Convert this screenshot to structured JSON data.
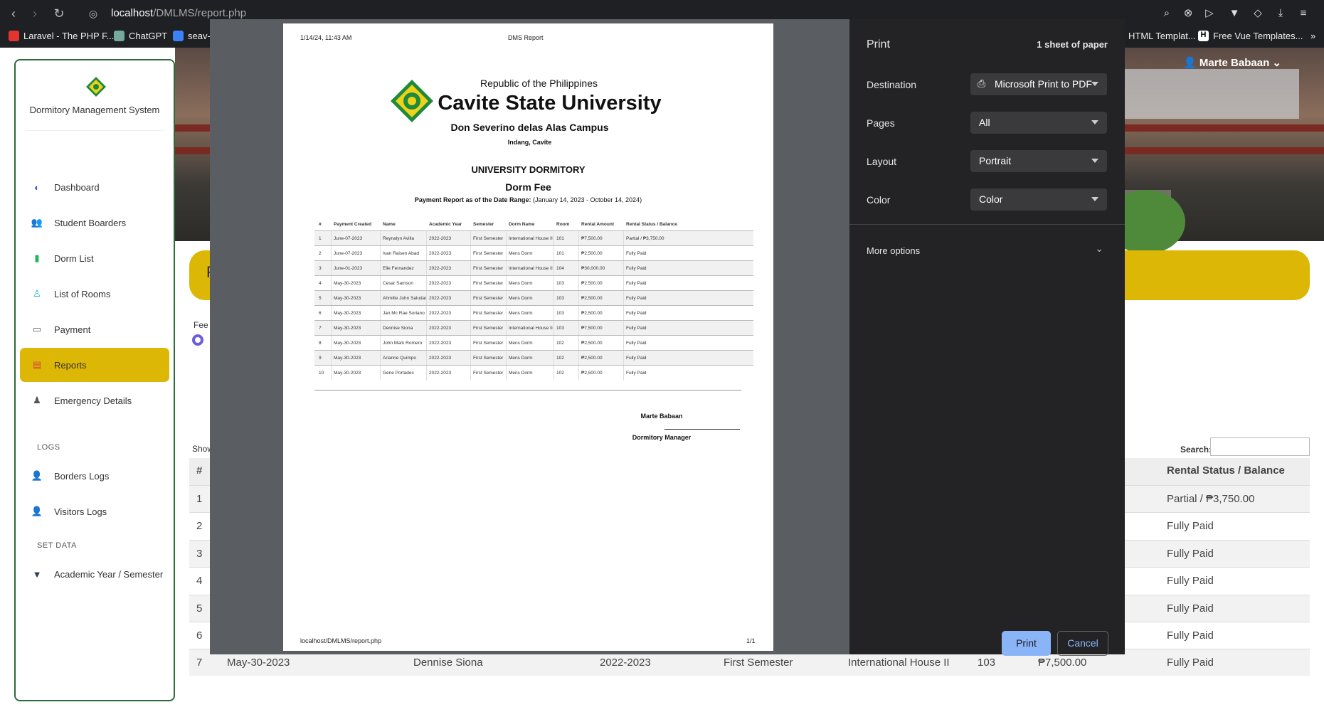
{
  "browser": {
    "url_host": "localhost",
    "url_path": "/DMLMS/report.php",
    "bookmarks": [
      {
        "label": "Laravel - The PHP F...",
        "color": "#e3342f"
      },
      {
        "label": "ChatGPT",
        "color": "#74aa9c"
      },
      {
        "label": "seav-c",
        "color": "#3b82f6"
      },
      {
        "label": "HTML Templat...",
        "color": "#888888"
      },
      {
        "label": "Free Vue Templates...",
        "color": "#ffffff"
      }
    ]
  },
  "header": {
    "user_name": "Marte Babaan"
  },
  "sidebar": {
    "brand": "Dormitory Management System",
    "items": [
      {
        "label": "Dashboard",
        "icon": "gauge-icon"
      },
      {
        "label": "Student Boarders",
        "icon": "users-icon"
      },
      {
        "label": "Dorm List",
        "icon": "building-icon"
      },
      {
        "label": "List of Rooms",
        "icon": "person-icon"
      },
      {
        "label": "Payment",
        "icon": "credit-card-icon"
      },
      {
        "label": "Reports",
        "icon": "file-icon"
      },
      {
        "label": "Emergency Details",
        "icon": "user-icon"
      }
    ],
    "logs_title": "LOGS",
    "logs": [
      {
        "label": "Borders Logs",
        "icon": "user-cog-icon"
      },
      {
        "label": "Visitors Logs",
        "icon": "user-cog-icon"
      }
    ],
    "setdata_title": "SET DATA",
    "setdata": [
      {
        "label": "Academic Year / Semester",
        "icon": "filter-icon"
      }
    ]
  },
  "main": {
    "banner_initial": "F",
    "fee_label": "Fee T",
    "show_label": "Show",
    "search_label": "Search:",
    "table_headers": {
      "num": "#",
      "status": "Rental Status / Balance"
    },
    "rows": [
      {
        "num": "1",
        "date": "",
        "name": "",
        "year": "",
        "sem": "",
        "dorm": "",
        "room": "",
        "amount": "",
        "status": "Partial / ₱3,750.00"
      },
      {
        "num": "2",
        "date": "",
        "name": "",
        "year": "",
        "sem": "",
        "dorm": "",
        "room": "",
        "amount": "",
        "status": "Fully Paid"
      },
      {
        "num": "3",
        "date": "",
        "name": "",
        "year": "",
        "sem": "",
        "dorm": "",
        "room": "",
        "amount": "",
        "status": "Fully Paid"
      },
      {
        "num": "4",
        "date": "",
        "name": "",
        "year": "",
        "sem": "",
        "dorm": "",
        "room": "",
        "amount": "",
        "status": "Fully Paid"
      },
      {
        "num": "5",
        "date": "",
        "name": "",
        "year": "",
        "sem": "",
        "dorm": "",
        "room": "",
        "amount": "",
        "status": "Fully Paid"
      },
      {
        "num": "6",
        "date": "May-30-2023",
        "name": "Jan Mc Rae Soriano",
        "year": "2022-2023",
        "sem": "First Semester",
        "dorm": "Mens Dorm",
        "room": "103",
        "amount": "₱2,500.00",
        "status": "Fully Paid"
      },
      {
        "num": "7",
        "date": "May-30-2023",
        "name": "Dennise Siona",
        "year": "2022-2023",
        "sem": "First Semester",
        "dorm": "International House II",
        "room": "103",
        "amount": "₱7,500.00",
        "status": "Fully Paid"
      }
    ]
  },
  "print_preview": {
    "header_date": "1/14/24, 11:43 AM",
    "header_title": "DMS Report",
    "republic": "Republic of the Philippines",
    "university": "Cavite State University",
    "campus": "Don Severino delas Alas Campus",
    "location": "Indang, Cavite",
    "dorm_title": "UNIVERSITY DORMITORY",
    "report_title": "Dorm Fee",
    "range_label": "Payment Report as of the Date Range:",
    "range_value": " (January 14, 2023 - October 14, 2024)",
    "columns": [
      "#",
      "Payment Created",
      "Name",
      "Academic Year",
      "Semester",
      "Dorm Name",
      "Room",
      "Rental Amount",
      "Rental Status / Balance"
    ],
    "rows": [
      [
        "1",
        "June-07-2023",
        "Reynalyn Avilla",
        "2022-2023",
        "First Semester",
        "International House II",
        "101",
        "₱7,500.00",
        "Partial / ₱3,750.00"
      ],
      [
        "2",
        "June-07-2023",
        "Ivan Raisen Abad",
        "2022-2023",
        "First Semester",
        "Mens Dorm",
        "101",
        "₱2,500.00",
        "Fully Paid"
      ],
      [
        "3",
        "June-01-2023",
        "Elle Fernandez",
        "2022-2023",
        "First Semester",
        "International House II",
        "104",
        "₱30,000.00",
        "Fully Paid"
      ],
      [
        "4",
        "May-30-2023",
        "Cesar Samson",
        "2022-2023",
        "First Semester",
        "Mens Dorm",
        "103",
        "₱2,500.00",
        "Fully Paid"
      ],
      [
        "5",
        "May-30-2023",
        "Ahmille John Saludar",
        "2022-2023",
        "First Semester",
        "Mens Dorm",
        "103",
        "₱2,500.00",
        "Fully Paid"
      ],
      [
        "6",
        "May-30-2023",
        "Jan Mc Rae Soriano",
        "2022-2023",
        "First Semester",
        "Mens Dorm",
        "103",
        "₱2,500.00",
        "Fully Paid"
      ],
      [
        "7",
        "May-30-2023",
        "Dennise Siona",
        "2022-2023",
        "First Semester",
        "International House II",
        "103",
        "₱7,500.00",
        "Fully Paid"
      ],
      [
        "8",
        "May-30-2023",
        "John Mark Romero",
        "2022-2023",
        "First Semester",
        "Mens Dorm",
        "102",
        "₱2,500.00",
        "Fully Paid"
      ],
      [
        "9",
        "May-30-2023",
        "Arianne Quimpo",
        "2022-2023",
        "First Semester",
        "Mens Dorm",
        "102",
        "₱2,500.00",
        "Fully Paid"
      ],
      [
        "10",
        "May-30-2023",
        "Gene Portades",
        "2022-2023",
        "First Semester",
        "Mens Dorm",
        "102",
        "₱2,500.00",
        "Fully Paid"
      ]
    ],
    "signer_name": "Marte Babaan",
    "signer_title": "Dormitory Manager",
    "footer_url": "localhost/DMLMS/report.php",
    "footer_page": "1/1"
  },
  "print_panel": {
    "title": "Print",
    "sheets": "1 sheet of paper",
    "destination_label": "Destination",
    "destination_value": "Microsoft Print to PDF",
    "pages_label": "Pages",
    "pages_value": "All",
    "layout_label": "Layout",
    "layout_value": "Portrait",
    "color_label": "Color",
    "color_value": "Color",
    "more_options": "More options",
    "print_button": "Print",
    "cancel_button": "Cancel"
  }
}
